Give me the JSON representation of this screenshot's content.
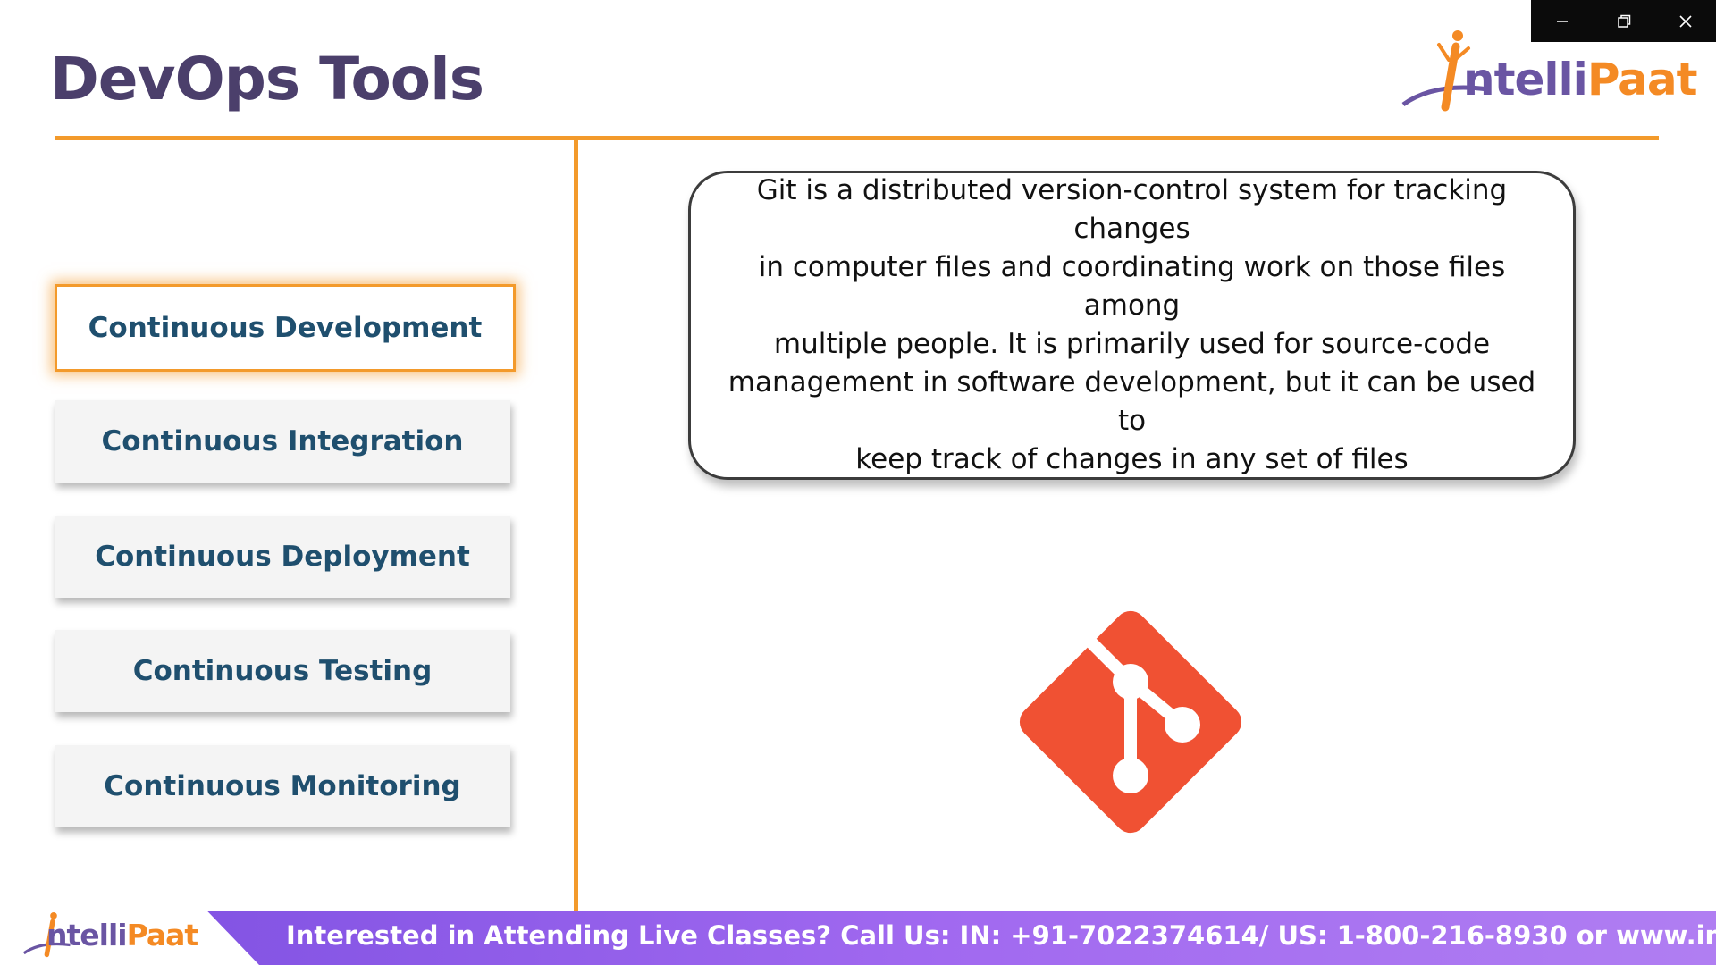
{
  "slide": {
    "title": "DevOps Tools"
  },
  "logo": {
    "part1": "ntelli",
    "part2": "Paat",
    "initial": "I",
    "brand_purple": "#6a55a3",
    "brand_orange": "#f48a24"
  },
  "window_controls": {
    "minimize_icon": "minimize-icon",
    "restore_icon": "restore-icon",
    "close_icon": "close-icon"
  },
  "stages": [
    {
      "label": "Continuous Development",
      "active": true
    },
    {
      "label": "Continuous Integration",
      "active": false
    },
    {
      "label": "Continuous Deployment",
      "active": false
    },
    {
      "label": "Continuous Testing",
      "active": false
    },
    {
      "label": "Continuous Monitoring",
      "active": false
    }
  ],
  "description": {
    "line1": "Git is a distributed version-control system for tracking changes",
    "line2": "in computer files and coordinating work on those files among",
    "line3": "multiple people. It is primarily used for source-code",
    "line4": "management in software development, but it can be used to",
    "line5": "keep track of changes in any set of files"
  },
  "tool_icon": "git-logo-icon",
  "banner": {
    "text": "Interested in Attending Live Classes? Call Us: IN: +91-7022374614/ US: 1-800-216-8930 or www.intellipaat.com"
  },
  "colors": {
    "accent_orange": "#f39a2b",
    "title_purple": "#4b3f6b",
    "button_text": "#1f4f6e",
    "git_orange": "#f05133",
    "banner_purple": "#8e5ae8"
  }
}
